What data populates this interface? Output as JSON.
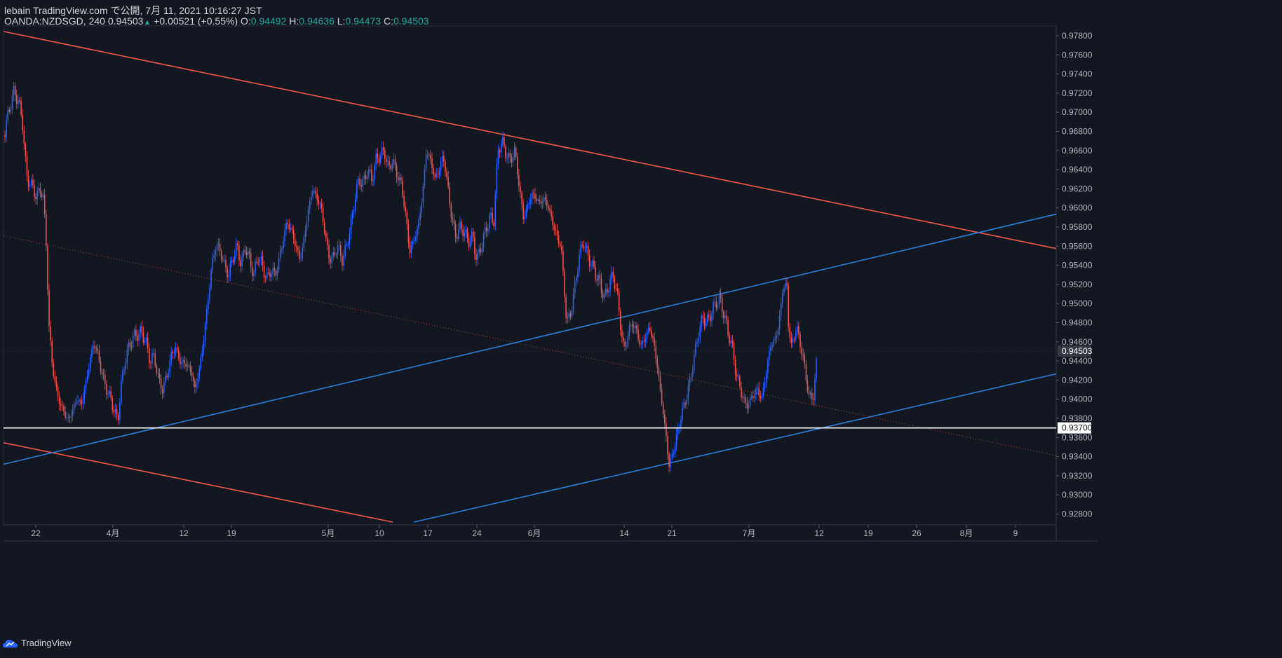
{
  "header": {
    "published": "lebain TradingView.com で公開, 7月 11, 2021 10:16:27 JST",
    "symbol": "OANDA:NZDSGD, 240",
    "last": "0.94503",
    "change": "+0.00521 (+0.55%)",
    "o_label": "O:",
    "o_value": "0.94492",
    "h_label": "H:",
    "h_value": "0.94636",
    "l_label": "L:",
    "l_value": "0.94473",
    "c_label": "C:",
    "c_value": "0.94503",
    "up_arrow": "▲"
  },
  "footer": {
    "brand": "TradingView",
    "icon": "tradingview-cloud-icon"
  },
  "colors": {
    "bg": "#131722",
    "up": "#2962ff",
    "down": "#ef5350",
    "trend_red": "#f15a4a",
    "trend_blue": "#2a7fd8",
    "support": "#ffffff"
  },
  "chart_data": {
    "type": "candlestick",
    "symbol": "OANDA:NZDSGD",
    "timeframe": "240",
    "ylim": [
      0.927,
      0.979
    ],
    "y_ticks": [
      "0.97800",
      "0.97600",
      "0.97400",
      "0.97200",
      "0.97000",
      "0.96800",
      "0.96600",
      "0.96400",
      "0.96200",
      "0.96000",
      "0.95800",
      "0.95600",
      "0.95400",
      "0.95200",
      "0.95000",
      "0.94800",
      "0.94600",
      "0.94400",
      "0.94200",
      "0.94000",
      "0.93800",
      "0.93600",
      "0.93400",
      "0.93200",
      "0.93000",
      "0.92800"
    ],
    "x_ticks": [
      "22",
      "4月",
      "12",
      "19",
      "5月",
      "10",
      "17",
      "24",
      "6月",
      "14",
      "21",
      "7月",
      "12",
      "19",
      "26",
      "8月",
      "9"
    ],
    "current_price_label": "0.94503",
    "support_label": "0.93700",
    "support_level": 0.937,
    "series": [
      {
        "points": [
          [
            0,
            0.9682
          ],
          [
            6,
            0.9675
          ],
          [
            12,
            0.97
          ],
          [
            20,
            0.9722
          ],
          [
            26,
            0.9712
          ],
          [
            32,
            0.969
          ],
          [
            38,
            0.9632
          ],
          [
            44,
            0.9625
          ],
          [
            52,
            0.9612
          ],
          [
            58,
            0.962
          ],
          [
            62,
            0.961
          ],
          [
            66,
            0.956
          ],
          [
            70,
            0.9475
          ],
          [
            74,
            0.944
          ],
          [
            80,
            0.941
          ],
          [
            86,
            0.9395
          ],
          [
            92,
            0.9385
          ],
          [
            98,
            0.9378
          ],
          [
            104,
            0.939
          ],
          [
            110,
            0.94
          ],
          [
            116,
            0.9395
          ],
          [
            122,
            0.9415
          ],
          [
            128,
            0.944
          ],
          [
            134,
            0.946
          ],
          [
            140,
            0.9445
          ],
          [
            146,
            0.9425
          ],
          [
            152,
            0.941
          ],
          [
            158,
            0.94
          ],
          [
            164,
            0.9385
          ],
          [
            168,
            0.9378
          ],
          [
            172,
            0.941
          ],
          [
            178,
            0.944
          ],
          [
            184,
            0.9455
          ],
          [
            190,
            0.9465
          ],
          [
            196,
            0.9468
          ],
          [
            202,
            0.947
          ],
          [
            208,
            0.946
          ],
          [
            214,
            0.944
          ],
          [
            220,
            0.9445
          ],
          [
            226,
            0.942
          ],
          [
            232,
            0.941
          ],
          [
            238,
            0.9425
          ],
          [
            244,
            0.9445
          ],
          [
            250,
            0.9455
          ],
          [
            256,
            0.944
          ],
          [
            262,
            0.9438
          ],
          [
            268,
            0.9435
          ],
          [
            274,
            0.9425
          ],
          [
            278,
            0.941
          ],
          [
            284,
            0.943
          ],
          [
            290,
            0.946
          ],
          [
            296,
            0.95
          ],
          [
            302,
            0.954
          ],
          [
            308,
            0.9562
          ],
          [
            314,
            0.9555
          ],
          [
            320,
            0.954
          ],
          [
            326,
            0.953
          ],
          [
            332,
            0.9548
          ],
          [
            338,
            0.956
          ],
          [
            344,
            0.954
          ],
          [
            350,
            0.956
          ],
          [
            356,
            0.9545
          ],
          [
            362,
            0.953
          ],
          [
            368,
            0.955
          ],
          [
            374,
            0.954
          ],
          [
            380,
            0.9525
          ],
          [
            386,
            0.9535
          ],
          [
            392,
            0.953
          ],
          [
            398,
            0.9545
          ],
          [
            404,
            0.957
          ],
          [
            410,
            0.9585
          ],
          [
            416,
            0.9575
          ],
          [
            422,
            0.956
          ],
          [
            428,
            0.9545
          ],
          [
            434,
            0.957
          ],
          [
            440,
            0.96
          ],
          [
            446,
            0.962
          ],
          [
            452,
            0.961
          ],
          [
            458,
            0.96
          ],
          [
            464,
            0.957
          ],
          [
            470,
            0.9545
          ],
          [
            476,
            0.955
          ],
          [
            482,
            0.956
          ],
          [
            488,
            0.9545
          ],
          [
            494,
            0.956
          ],
          [
            500,
            0.958
          ],
          [
            506,
            0.961
          ],
          [
            512,
            0.963
          ],
          [
            518,
            0.9625
          ],
          [
            524,
            0.964
          ],
          [
            530,
            0.963
          ],
          [
            536,
            0.965
          ],
          [
            542,
            0.9655
          ],
          [
            548,
            0.966
          ],
          [
            554,
            0.964
          ],
          [
            560,
            0.965
          ],
          [
            566,
            0.9635
          ],
          [
            572,
            0.9625
          ],
          [
            578,
            0.9595
          ],
          [
            584,
            0.9555
          ],
          [
            590,
            0.9565
          ],
          [
            596,
            0.958
          ],
          [
            602,
            0.961
          ],
          [
            608,
            0.966
          ],
          [
            614,
            0.965
          ],
          [
            620,
            0.963
          ],
          [
            626,
            0.964
          ],
          [
            632,
            0.9655
          ],
          [
            638,
            0.9625
          ],
          [
            644,
            0.959
          ],
          [
            650,
            0.957
          ],
          [
            656,
            0.958
          ],
          [
            662,
            0.9575
          ],
          [
            668,
            0.9565
          ],
          [
            674,
            0.957
          ],
          [
            680,
            0.9545
          ],
          [
            686,
            0.956
          ],
          [
            692,
            0.9575
          ],
          [
            698,
            0.959
          ],
          [
            704,
            0.9585
          ],
          [
            710,
            0.966
          ],
          [
            716,
            0.967
          ],
          [
            722,
            0.9655
          ],
          [
            728,
            0.965
          ],
          [
            734,
            0.966
          ],
          [
            740,
            0.9625
          ],
          [
            746,
            0.959
          ],
          [
            752,
            0.96
          ],
          [
            758,
            0.9615
          ],
          [
            764,
            0.961
          ],
          [
            770,
            0.9605
          ],
          [
            776,
            0.961
          ],
          [
            782,
            0.96
          ],
          [
            788,
            0.9585
          ],
          [
            794,
            0.957
          ],
          [
            800,
            0.956
          ],
          [
            804,
            0.952
          ],
          [
            808,
            0.948
          ],
          [
            814,
            0.949
          ],
          [
            820,
            0.952
          ],
          [
            826,
            0.955
          ],
          [
            832,
            0.9565
          ],
          [
            838,
            0.955
          ],
          [
            844,
            0.954
          ],
          [
            850,
            0.953
          ],
          [
            856,
            0.952
          ],
          [
            862,
            0.9505
          ],
          [
            868,
            0.952
          ],
          [
            874,
            0.953
          ],
          [
            880,
            0.951
          ],
          [
            886,
            0.947
          ],
          [
            890,
            0.945
          ],
          [
            896,
            0.947
          ],
          [
            902,
            0.948
          ],
          [
            908,
            0.947
          ],
          [
            914,
            0.9455
          ],
          [
            920,
            0.9465
          ],
          [
            926,
            0.9475
          ],
          [
            932,
            0.946
          ],
          [
            938,
            0.943
          ],
          [
            944,
            0.9395
          ],
          [
            950,
            0.936
          ],
          [
            954,
            0.933
          ],
          [
            960,
            0.9345
          ],
          [
            966,
            0.9365
          ],
          [
            972,
            0.9385
          ],
          [
            978,
            0.94
          ],
          [
            984,
            0.942
          ],
          [
            990,
            0.9445
          ],
          [
            996,
            0.947
          ],
          [
            1002,
            0.9485
          ],
          [
            1008,
            0.948
          ],
          [
            1014,
            0.949
          ],
          [
            1020,
            0.95
          ],
          [
            1026,
            0.9505
          ],
          [
            1032,
            0.949
          ],
          [
            1038,
            0.947
          ],
          [
            1044,
            0.9455
          ],
          [
            1050,
            0.9425
          ],
          [
            1056,
            0.941
          ],
          [
            1062,
            0.9395
          ],
          [
            1068,
            0.9395
          ],
          [
            1074,
            0.9405
          ],
          [
            1080,
            0.941
          ],
          [
            1086,
            0.94
          ],
          [
            1092,
            0.9425
          ],
          [
            1098,
            0.9455
          ],
          [
            1104,
            0.946
          ],
          [
            1110,
            0.9475
          ],
          [
            1116,
            0.9515
          ],
          [
            1122,
            0.952
          ],
          [
            1124,
            0.948
          ],
          [
            1128,
            0.9455
          ],
          [
            1132,
            0.9465
          ],
          [
            1136,
            0.9475
          ],
          [
            1142,
            0.9455
          ],
          [
            1148,
            0.943
          ],
          [
            1154,
            0.94
          ],
          [
            1160,
            0.9405
          ],
          [
            1166,
            0.945
          ]
        ]
      }
    ],
    "trendlines": [
      {
        "color": "red",
        "style": "solid",
        "from": [
          5,
          0.97845
        ],
        "to": [
          1506,
          0.95575
        ]
      },
      {
        "color": "red",
        "style": "solid",
        "from": [
          5,
          0.93545
        ],
        "to": [
          560,
          0.92715
        ]
      },
      {
        "color": "blue",
        "style": "solid",
        "from": [
          5,
          0.9332
        ],
        "to": [
          1506,
          0.95935
        ]
      },
      {
        "color": "blue",
        "style": "solid",
        "from": [
          590,
          0.92715
        ],
        "to": [
          1506,
          0.94265
        ]
      },
      {
        "color": "red",
        "style": "dotted",
        "from": [
          5,
          0.9571
        ],
        "to": [
          1506,
          0.9341
        ]
      }
    ]
  }
}
